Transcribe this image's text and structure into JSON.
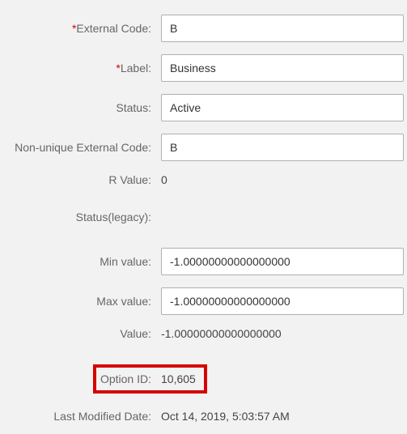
{
  "fields": {
    "external_code": {
      "label": "External Code:",
      "value": "B",
      "required": true
    },
    "label_field": {
      "label": "Label:",
      "value": "Business",
      "required": true
    },
    "status": {
      "label": "Status:",
      "value": "Active"
    },
    "nonunique_code": {
      "label": "Non-unique External Code:",
      "value": "B"
    },
    "r_value": {
      "label": "R Value:",
      "value": "0"
    },
    "status_legacy": {
      "label": "Status(legacy):",
      "value": ""
    },
    "min_value": {
      "label": "Min value:",
      "value": "-1.00000000000000000"
    },
    "max_value": {
      "label": "Max value:",
      "value": "-1.00000000000000000"
    },
    "value": {
      "label": "Value:",
      "value": "-1.00000000000000000"
    },
    "option_id": {
      "label": "Option ID:",
      "value": "10,605"
    },
    "last_modified": {
      "label": "Last Modified Date:",
      "value": "Oct 14, 2019, 5:03:57 AM"
    }
  }
}
